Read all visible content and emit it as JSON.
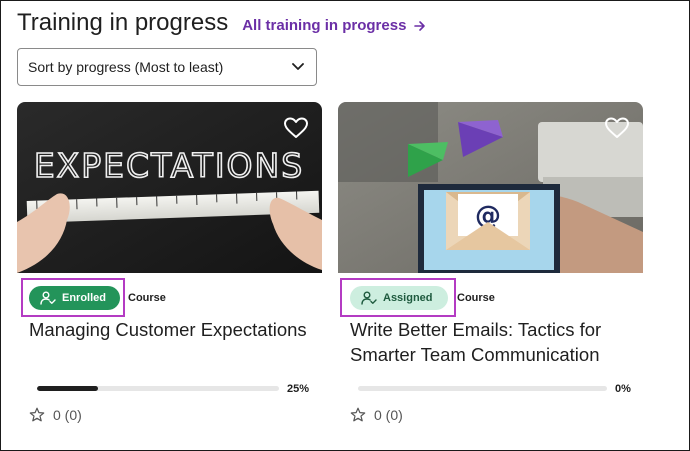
{
  "header": {
    "title": "Training in progress",
    "all_link": "All training in progress"
  },
  "sort": {
    "selected": "Sort by progress (Most to least)"
  },
  "cards": [
    {
      "image_text": "EXPECTATIONS",
      "status": "Enrolled",
      "status_color": "#23945a",
      "type": "Course",
      "title": "Managing Customer Expectations",
      "progress": 0.25,
      "progress_label": "25%",
      "rating": "0 (0)"
    },
    {
      "image_text": "@",
      "status": "Assigned",
      "status_color": "#cdeedf",
      "type": "Course",
      "title": "Write Better Emails: Tactics for Smarter Team Communication",
      "progress": 0,
      "progress_label": "0%",
      "rating": "0 (0)"
    }
  ],
  "colors": {
    "accent": "#6b2fa6",
    "outline": "#b43bc3"
  },
  "icons": {
    "link": "arrow-right-icon",
    "sort": "chevron-down-icon",
    "favorite": "heart-icon",
    "status": "person-check-icon",
    "rating": "star-icon"
  }
}
